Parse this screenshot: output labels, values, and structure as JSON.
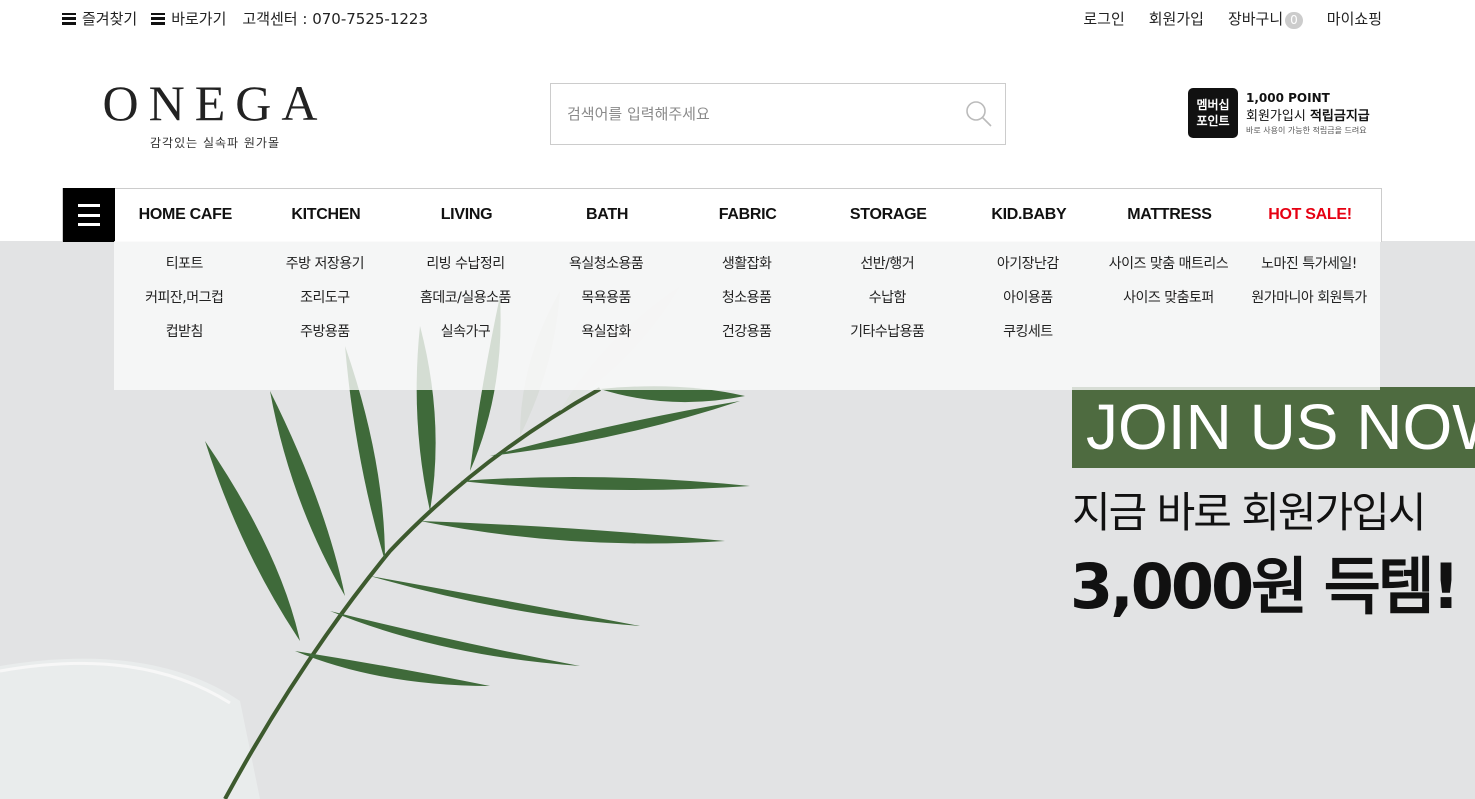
{
  "topbar": {
    "bookmark": "즐겨찾기",
    "shortcut": "바로가기",
    "cs": "고객센터 : 070-7525-1223",
    "login": "로그인",
    "signup": "회원가입",
    "cart": "장바구니",
    "cart_count": "0",
    "mypage": "마이쇼핑"
  },
  "logo": {
    "mark": "ONEGA",
    "tagline": "감각있는 실속파 원가몰"
  },
  "search": {
    "placeholder": "검색어를 입력해주세요"
  },
  "membership": {
    "badge_line1": "멤버십",
    "badge_line2": "포인트",
    "point": "1,000 POINT",
    "line2_a": "회원가입시 ",
    "line2_b": "적립금지급",
    "line3": "바로 사용이 가능한 적립금을 드려요"
  },
  "nav": {
    "categories": [
      {
        "label": "HOME CAFE",
        "items": [
          "티포트",
          "커피잔,머그컵",
          "컵받침"
        ]
      },
      {
        "label": "KITCHEN",
        "items": [
          "주방 저장용기",
          "조리도구",
          "주방용품"
        ]
      },
      {
        "label": "LIVING",
        "items": [
          "리빙 수납정리",
          "홈데코/실용소품",
          "실속가구"
        ]
      },
      {
        "label": "BATH",
        "items": [
          "욕실청소용품",
          "목욕용품",
          "욕실잡화"
        ]
      },
      {
        "label": "FABRIC",
        "items": [
          "생활잡화",
          "청소용품",
          "건강용품"
        ]
      },
      {
        "label": "STORAGE",
        "items": [
          "선반/행거",
          "수납함",
          "기타수납용품"
        ]
      },
      {
        "label": "KID.BABY",
        "items": [
          "아기장난감",
          "아이용품",
          "쿠킹세트"
        ]
      },
      {
        "label": "MATTRESS",
        "items": [
          "사이즈 맞춤 매트리스",
          "사이즈 맞춤토퍼"
        ]
      },
      {
        "label": "HOT SALE!",
        "items": [
          "노마진 특가세일!",
          "원가마니아 회원특가"
        ]
      }
    ]
  },
  "hero": {
    "join": "JOIN US NOW",
    "copy1": "지금 바로 회원가입시",
    "copy2": "3,000원 득템!"
  },
  "colors": {
    "join_bg": "#4e6b40",
    "hot": "#e60012",
    "hero_bg": "#e2e3e4"
  }
}
